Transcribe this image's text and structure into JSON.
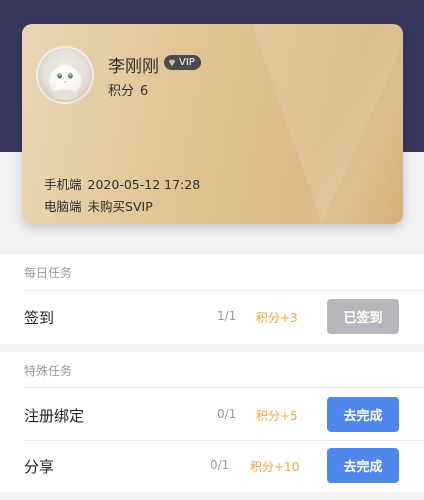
{
  "profile": {
    "name": "李刚刚",
    "vip_badge": "VIP",
    "points_label": "积分",
    "points_value": "6",
    "mobile_label": "手机端",
    "mobile_value": "2020-05-12 17:28",
    "pc_label": "电脑端",
    "pc_value": "未购买SVIP"
  },
  "daily": {
    "title": "每日任务",
    "tasks": [
      {
        "label": "签到",
        "progress": "1/1",
        "reward": "积分+3",
        "button": "已签到",
        "button_state": "done"
      }
    ]
  },
  "special": {
    "title": "特殊任务",
    "tasks": [
      {
        "label": "注册绑定",
        "progress": "0/1",
        "reward": "积分+5",
        "button": "去完成",
        "button_state": "todo"
      },
      {
        "label": "分享",
        "progress": "0/1",
        "reward": "积分+10",
        "button": "去完成",
        "button_state": "todo"
      }
    ]
  },
  "colors": {
    "header_bg": "#38385e",
    "reward": "#f2a63b",
    "button_primary": "#4f86ec",
    "button_disabled": "#b6b7ba"
  }
}
